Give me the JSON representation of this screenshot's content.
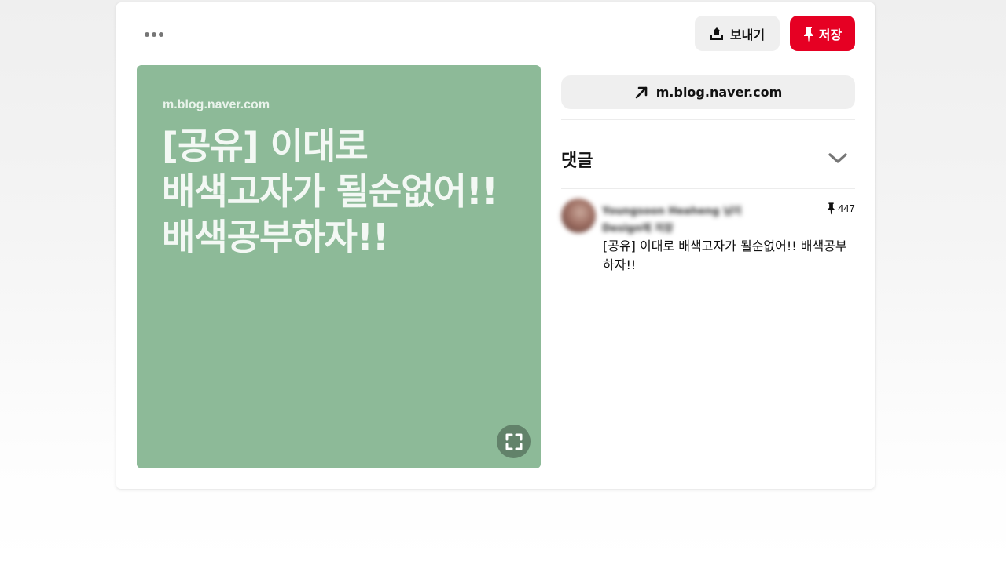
{
  "toolbar": {
    "more_icon": "ellipsis-icon",
    "share_label": "보내기",
    "share_icon": "share-upload-icon",
    "save_label": "저장",
    "save_icon": "pushpin-icon",
    "save_color": "#e60023"
  },
  "pin": {
    "image_domain": "m.blog.naver.com",
    "image_headline": "[공유] 이대로\n배색고자가 될순없어!!\n배색공부하자!!",
    "image_bg_color": "#8dba98",
    "expand_icon": "fullscreen-expand-icon"
  },
  "link": {
    "icon": "arrow-up-right-icon",
    "label": "m.blog.naver.com"
  },
  "comments": {
    "title": "댓글",
    "toggle_icon": "chevron-down-icon"
  },
  "pinner": {
    "name_blurred": "Youngsoon Heaheng 님이 Design에 저장",
    "pin_count": "447",
    "pin_count_icon": "pushpin-icon",
    "description": "[공유] 이대로 배색고자가 될순없어!! 배색공부하자!!"
  }
}
